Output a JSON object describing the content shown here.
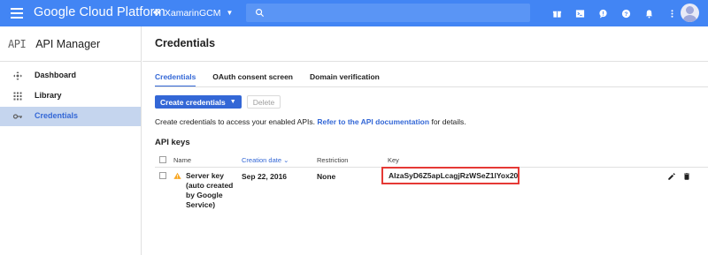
{
  "topbar": {
    "brand": "Google Cloud Platform",
    "project": "XamarinGCM",
    "icons": [
      "gift-icon",
      "terminal-icon",
      "feedback-icon",
      "help-icon",
      "notifications-icon"
    ]
  },
  "sidebar": {
    "logo": "API",
    "title": "API Manager",
    "items": [
      {
        "label": "Dashboard",
        "icon": "dashboard-icon"
      },
      {
        "label": "Library",
        "icon": "library-icon"
      },
      {
        "label": "Credentials",
        "icon": "key-icon",
        "active": true
      }
    ]
  },
  "main": {
    "title": "Credentials",
    "tabs": [
      "Credentials",
      "OAuth consent screen",
      "Domain verification"
    ],
    "create_button": "Create credentials",
    "delete_button": "Delete",
    "description": "Create credentials to access your enabled APIs.",
    "description_link": "Refer to the API documentation",
    "description_end": "for details.",
    "section_title": "API keys",
    "table": {
      "headers": {
        "name": "Name",
        "creation_date": "Creation date",
        "restriction": "Restriction",
        "key": "Key"
      },
      "rows": [
        {
          "name": "Server key (auto created by Google Service)",
          "creation_date": "Sep 22, 2016",
          "restriction": "None",
          "key": "AIzaSyD6Z5apLcagjRzWSeZ1lYox20"
        }
      ]
    }
  },
  "colors": {
    "topbar": "#4285f4",
    "accent": "#3367d6",
    "highlight_border": "#e53935",
    "warning": "#f9a825"
  }
}
